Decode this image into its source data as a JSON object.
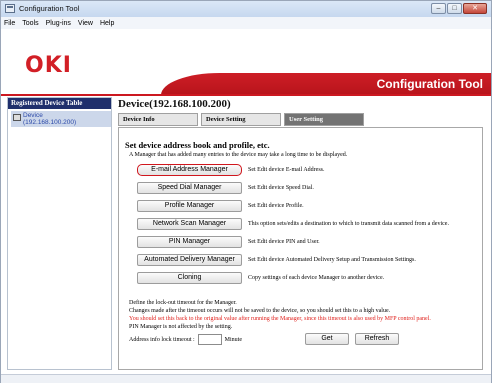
{
  "window": {
    "title": "Configuration Tool",
    "controls": {
      "minimize": "–",
      "maximize": "□",
      "close": "✕"
    }
  },
  "menu": {
    "items": [
      "File",
      "Tools",
      "Plug-ins",
      "View",
      "Help"
    ]
  },
  "header": {
    "logo": "OKI",
    "app_title": "Configuration Tool",
    "brand_color": "#cc1820"
  },
  "sidebar": {
    "heading": "Registered Device Table",
    "device": {
      "name": "Device",
      "address": "(192.168.100.200)",
      "icon": "device-icon"
    }
  },
  "main": {
    "device_title": "Device(192.168.100.200)",
    "tabs": [
      {
        "label": "Device Info",
        "active": false
      },
      {
        "label": "Device Setting",
        "active": false
      },
      {
        "label": "User Setting",
        "active": true
      }
    ],
    "section_title": "Set device address book and profile, etc.",
    "section_note": "A Manager that has added many entries to the device may take a long time to be displayed.",
    "managers": [
      {
        "label": "E-mail Address Manager",
        "desc": "Set Edit device E-mail Address.",
        "focused": true
      },
      {
        "label": "Speed Dial Manager",
        "desc": "Set Edit device Speed Dial.",
        "focused": false
      },
      {
        "label": "Profile Manager",
        "desc": "Set Edit device Profile.",
        "focused": false
      },
      {
        "label": "Network Scan Manager",
        "desc": "This option sets/edits a destination to which to transmit data scanned from a device.",
        "focused": false
      },
      {
        "label": "PIN Manager",
        "desc": "Set Edit device PIN and User.",
        "focused": false
      },
      {
        "label": "Automated Delivery Manager",
        "desc": "Set Edit device Automated Delivery Setup and Transmission Settings.",
        "focused": false
      },
      {
        "label": "Cloning",
        "desc": "Copy settings of each device Manager to another device.",
        "focused": false
      }
    ],
    "lock": {
      "line1": "Define the lock-out timeout for the Manager.",
      "line2": "Changes made after the timeout occurs will not be saved to the device, so you should set this to a high value.",
      "line3_red": "You should set this back to the original value after running the Manager, since this timeout is also used by MFP control panel.",
      "line4": "PIN Manager is not affected by the setting.",
      "timeout_label": "Address info lock timeout :",
      "timeout_value": "",
      "timeout_unit": "Minute",
      "get_label": "Get",
      "refresh_label": "Refresh"
    }
  }
}
